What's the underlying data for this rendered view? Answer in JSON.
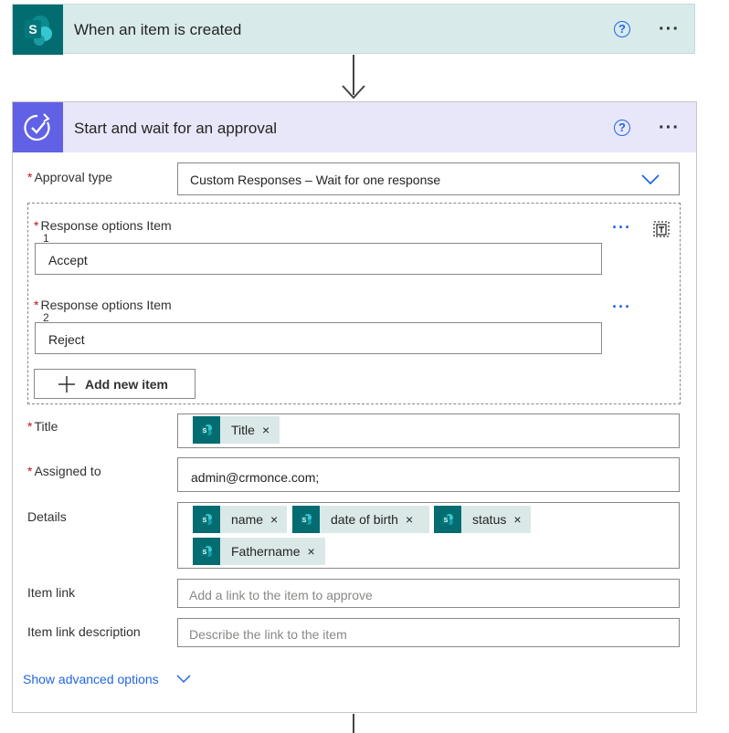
{
  "trigger": {
    "title": "When an item is created",
    "help_icon": "question-circle-icon",
    "more_icon": "more-horizontal-icon",
    "app_icon": "sharepoint-icon"
  },
  "action": {
    "title": "Start and wait for an approval",
    "app_icon": "approval-icon",
    "fields": {
      "approval_type": {
        "label": "Approval type",
        "value": "Custom Responses – Wait for one response"
      },
      "response_options": [
        {
          "label": "Response options Item",
          "index": "1",
          "value": "Accept"
        },
        {
          "label": "Response options Item",
          "index": "2",
          "value": "Reject"
        }
      ],
      "add_new_item": "Add new item",
      "title": {
        "label": "Title",
        "tokens": [
          "Title"
        ]
      },
      "assigned_to": {
        "label": "Assigned to",
        "value": "admin@crmonce.com;"
      },
      "details": {
        "label": "Details",
        "tokens": [
          "name",
          "date of birth",
          "status",
          "Fathername"
        ]
      },
      "item_link": {
        "label": "Item link",
        "placeholder": "Add a link to the item to approve"
      },
      "item_link_description": {
        "label": "Item link description",
        "placeholder": "Describe the link to the item"
      }
    },
    "show_advanced": "Show advanced options",
    "required_mark": "*",
    "remove_mark": "×"
  },
  "colors": {
    "sharepoint_teal": "#036c70",
    "approval_purple": "#6161e6",
    "link_blue": "#2266e3",
    "required_red": "#c50f1f"
  }
}
